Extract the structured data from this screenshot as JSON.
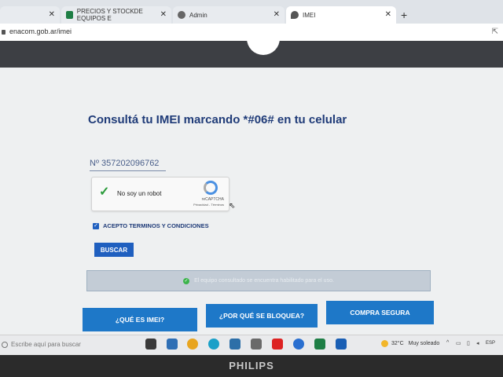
{
  "browser": {
    "tabs": [
      {
        "label": "",
        "active": false
      },
      {
        "label": "PRECIOS Y STOCKDE EQUIPOS E",
        "active": false,
        "icon": "spreadsheet-icon"
      },
      {
        "label": "Admin",
        "active": false,
        "icon": "globe-icon"
      },
      {
        "label": "IMEI",
        "active": true,
        "icon": "enacom-icon"
      }
    ],
    "new_tab": "+",
    "url": "enacom.gob.ar/imei"
  },
  "page": {
    "title": "Consultá tu IMEI marcando *#06# en tu celular",
    "imei_value": "Nº 357202096762",
    "captcha": {
      "label": "No soy un robot",
      "brand": "reCAPTCHA",
      "links": "Privacidad - Términos",
      "checked": true
    },
    "terms_label": "ACEPTO TERMINOS Y CONDICIONES",
    "terms_checked": true,
    "search_button": "BUSCAR",
    "result_message": "El equipo consultado se encuentra habilitado para el uso.",
    "buttons": {
      "what_is": "¿QUÉ ES IMEI?",
      "why_blocked": "¿POR QUÉ SE BLOQUEA?",
      "safe_buy": "COMPRA SEGURA"
    }
  },
  "taskbar": {
    "search_placeholder": "Escribe aquí para buscar",
    "weather_temp": "32°C",
    "weather_desc": "Muy soleado",
    "lang": "ESP"
  },
  "monitor_brand": "PHILIPS",
  "colors": {
    "title": "#1f3b78",
    "button": "#1e78c8",
    "header": "#3d3f44",
    "success": "#3bb44a"
  }
}
